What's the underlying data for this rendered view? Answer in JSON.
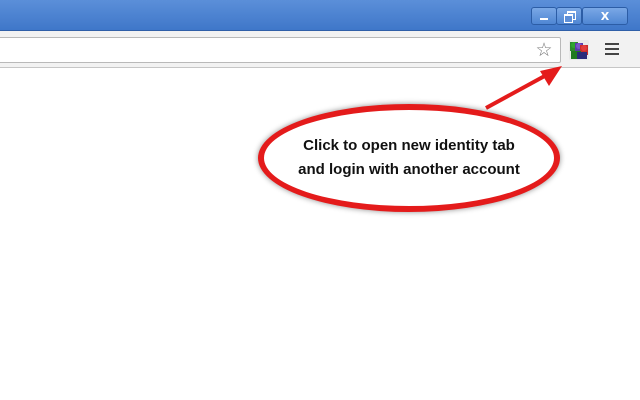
{
  "window": {
    "minimize_icon": "minimize-icon",
    "restore_icon": "restore-icon",
    "close_label": "X"
  },
  "toolbar": {
    "address_value": "",
    "bookmark_icon": "star-icon",
    "extension_icon": "multi-identity-icon",
    "menu_icon": "menu-icon"
  },
  "callout": {
    "line1": "Click to open new identity tab",
    "line2": "and login with another account"
  },
  "colors": {
    "titlebar": "#4a80cf",
    "callout_border": "#e41b1b",
    "arrow": "#e41b1b"
  }
}
